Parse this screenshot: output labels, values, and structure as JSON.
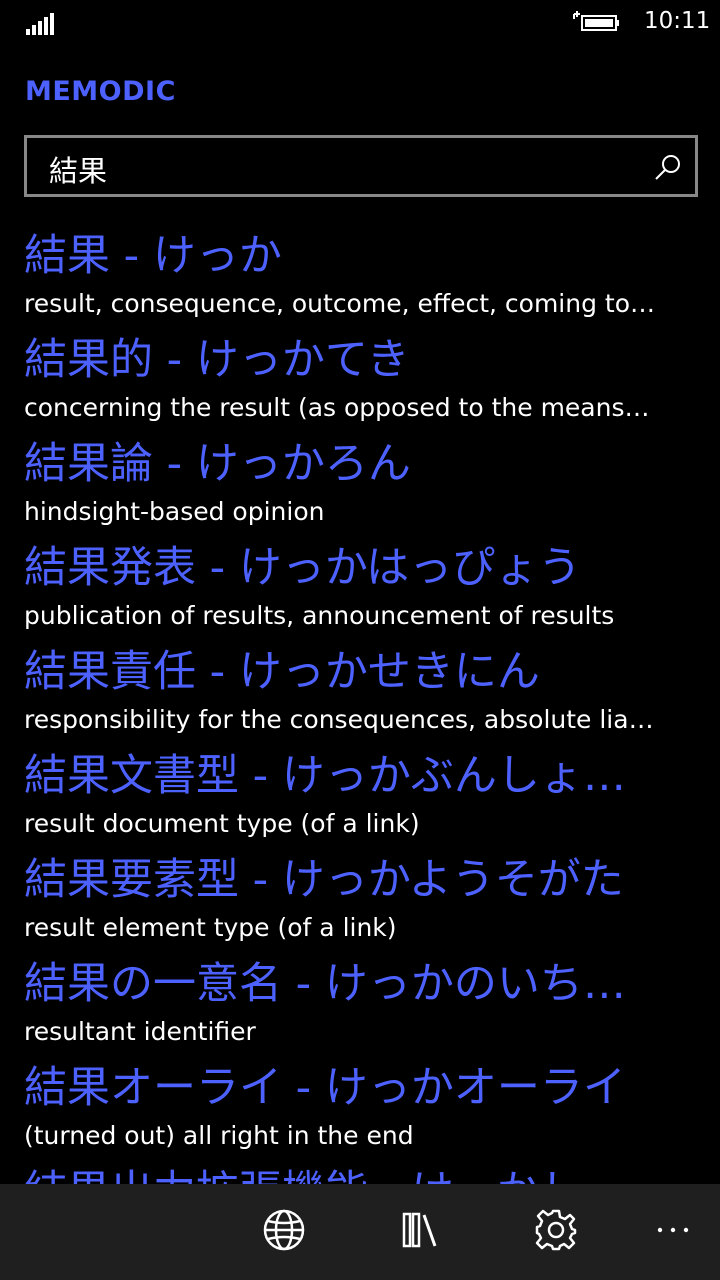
{
  "status": {
    "time": "10:11"
  },
  "app": {
    "title": "MEMODIC"
  },
  "search": {
    "value": "結果"
  },
  "results": [
    {
      "word": "結果 - けっか",
      "definition": "result, consequence, outcome, effect, coming to…"
    },
    {
      "word": "結果的 - けっかてき",
      "definition": "concerning the result (as opposed to the means…"
    },
    {
      "word": "結果論 - けっかろん",
      "definition": "hindsight-based opinion"
    },
    {
      "word": "結果発表 - けっかはっぴょう",
      "definition": "publication of results, announcement of results"
    },
    {
      "word": "結果責任 - けっかせきにん",
      "definition": "responsibility for the consequences, absolute lia…"
    },
    {
      "word": "結果文書型 - けっかぶんしょがた",
      "definition": "result document type (of a link)"
    },
    {
      "word": "結果要素型 - けっかようそがた",
      "definition": "result element type (of a link)"
    },
    {
      "word": "結果の一意名 - けっかのいちい…",
      "definition": "resultant identifier"
    },
    {
      "word": "結果オーライ - けっかオーライ",
      "definition": "(turned out) all right in the end"
    },
    {
      "word": "結果出力拡張機能 - けっかしゅ…",
      "definition": ""
    }
  ],
  "app_bar": {
    "icons": [
      "globe-icon",
      "library-icon",
      "gear-icon",
      "more-icon"
    ]
  },
  "colors": {
    "accent": "#4d61ff",
    "background": "#000000",
    "app_bar": "#1f1f1f"
  }
}
